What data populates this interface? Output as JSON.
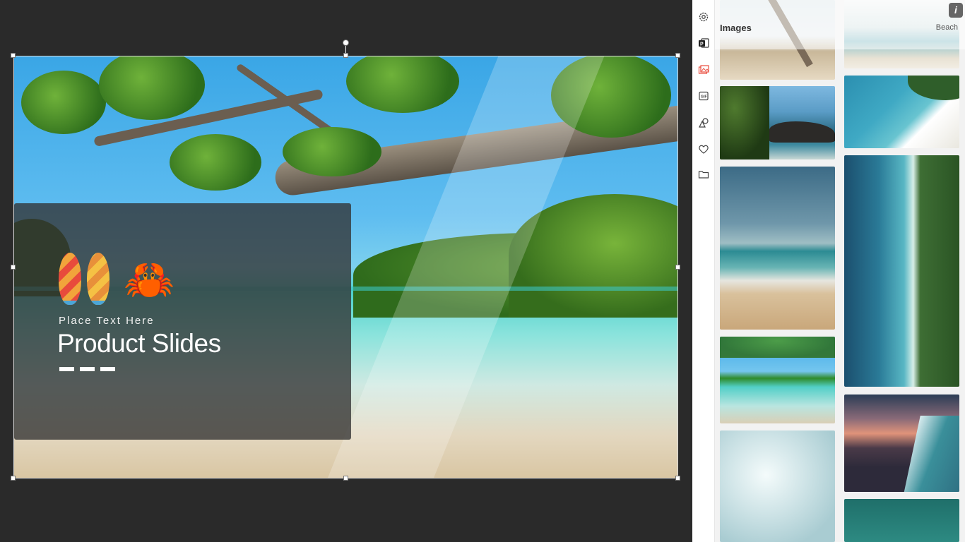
{
  "slide": {
    "subtitle": "Place Text Here",
    "title": "Product Slides",
    "icons": [
      "surfboard-icon",
      "crab-icon"
    ]
  },
  "toolbar": {
    "tools": [
      "settings-icon",
      "powerpoint-icon",
      "images-icon",
      "gif-icon",
      "shapes-icon",
      "favorites-icon",
      "folder-icon"
    ]
  },
  "panel": {
    "title": "Images",
    "category": "Beach",
    "info": "i"
  },
  "colors": {
    "canvas_bg": "#2a2a2a",
    "overlay": "#323232",
    "panel_bg": "#f2f2f2",
    "accent_red": "#e84b3c"
  }
}
